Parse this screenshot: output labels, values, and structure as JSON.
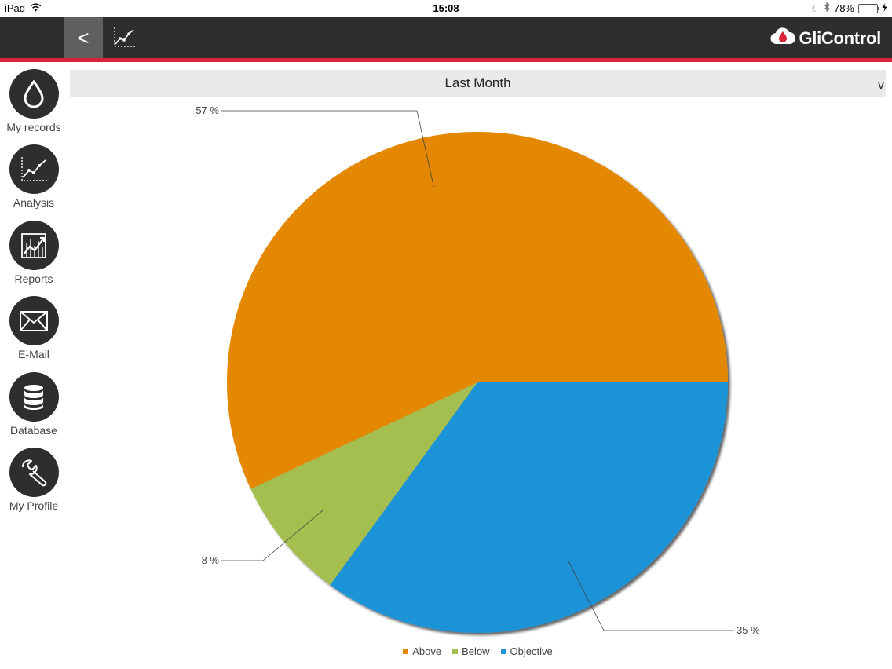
{
  "status_bar": {
    "device": "iPad",
    "time": "15:08",
    "battery_text": "78%",
    "battery_level": 0.78,
    "icons": [
      "wifi-icon",
      "moon-icon",
      "bluetooth-icon",
      "battery-icon",
      "charging-icon"
    ]
  },
  "topbar": {
    "back_label": "<",
    "chart_icon": "line-chart-icon",
    "brand_name": "GliControl",
    "brand_icon": "cloud-drop-icon",
    "accent_color": "#d7243b"
  },
  "sidebar": {
    "items": [
      {
        "label": "My records",
        "icon": "drop-icon"
      },
      {
        "label": "Analysis",
        "icon": "line-chart-icon"
      },
      {
        "label": "Reports",
        "icon": "report-chart-icon"
      },
      {
        "label": "E-Mail",
        "icon": "envelope-icon"
      },
      {
        "label": "Database",
        "icon": "database-icon"
      },
      {
        "label": "My Profile",
        "icon": "wrench-icon"
      }
    ]
  },
  "period_selector": {
    "selected": "Last Month",
    "caret": "v"
  },
  "chart_data": {
    "type": "pie",
    "series": [
      {
        "name": "Above",
        "value": 57,
        "label": "57 %",
        "color": "#e38800"
      },
      {
        "name": "Below",
        "value": 8,
        "label": "8 %",
        "color": "#a4bf50"
      },
      {
        "name": "Objective",
        "value": 35,
        "label": "35 %",
        "color": "#1e93d7"
      }
    ],
    "legend": [
      "Above",
      "Below",
      "Objective"
    ],
    "legend_position": "bottom"
  }
}
